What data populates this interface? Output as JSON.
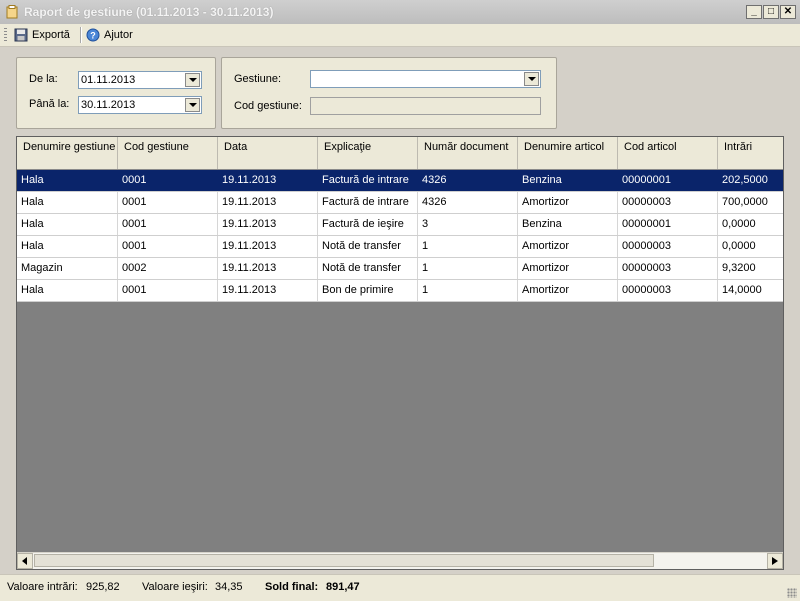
{
  "window": {
    "title": "Raport de gestiune (01.11.2013 - 30.11.2013)"
  },
  "toolbar": {
    "export_label": "Exportă",
    "help_label": "Ajutor"
  },
  "filters": {
    "from_label": "De la:",
    "from_value": "01.11.2013",
    "to_label": "Până la:",
    "to_value": "30.11.2013",
    "gestiune_label": "Gestiune:",
    "gestiune_value": "",
    "cod_label": "Cod gestiune:",
    "cod_value": ""
  },
  "grid": {
    "columns": [
      "Denumire gestiune",
      "Cod gestiune",
      "Data",
      "Explicaţie",
      "Număr document",
      "Denumire articol",
      "Cod articol",
      "Intrări"
    ],
    "rows": [
      [
        "Hala",
        "0001",
        "19.11.2013",
        "Factură de intrare",
        "4326",
        "Benzina",
        "00000001",
        "202,5000"
      ],
      [
        "Hala",
        "0001",
        "19.11.2013",
        "Factură de intrare",
        "4326",
        "Amortizor",
        "00000003",
        "700,0000"
      ],
      [
        "Hala",
        "0001",
        "19.11.2013",
        "Factură de ieşire",
        "3",
        "Benzina",
        "00000001",
        "0,0000"
      ],
      [
        "Hala",
        "0001",
        "19.11.2013",
        "Notă de transfer",
        "1",
        "Amortizor",
        "00000003",
        "0,0000"
      ],
      [
        "Magazin",
        "0002",
        "19.11.2013",
        "Notă de transfer",
        "1",
        "Amortizor",
        "00000003",
        "9,3200"
      ],
      [
        "Hala",
        "0001",
        "19.11.2013",
        "Bon de primire",
        "1",
        "Amortizor",
        "00000003",
        "14,0000"
      ]
    ]
  },
  "status": {
    "intrari_label": "Valoare intrări:",
    "intrari_value": "925,82",
    "iesiri_label": "Valoare ieşiri:",
    "iesiri_value": "34,35",
    "sold_label": "Sold final:",
    "sold_value": "891,47"
  },
  "colors": {
    "selected_row": "#0a246a",
    "grid_empty": "#808080"
  }
}
